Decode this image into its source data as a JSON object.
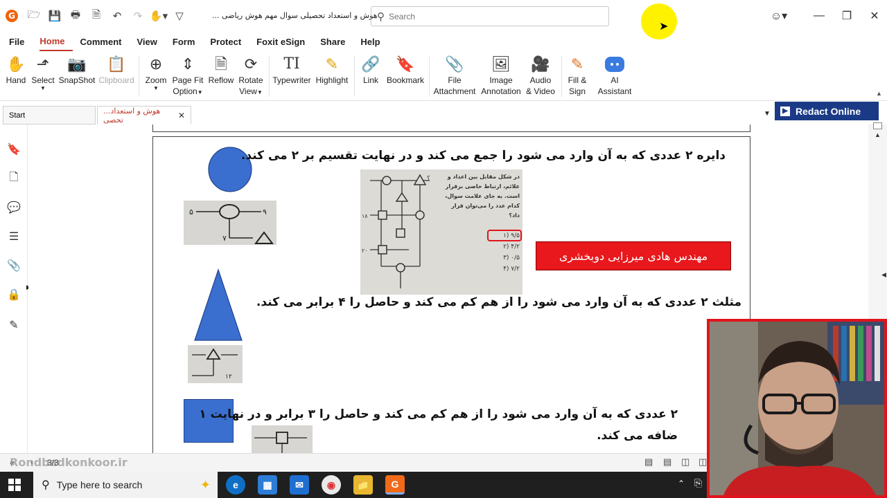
{
  "titlebar": {
    "doc_title": "... هوش و استعداد تحصیلی سوال مهم هوش ریاضی",
    "search_placeholder": "Search"
  },
  "menu": [
    "File",
    "Home",
    "Comment",
    "View",
    "Form",
    "Protect",
    "Foxit eSign",
    "Share",
    "Help"
  ],
  "ribbon": {
    "hand": "Hand",
    "select": "Select",
    "snapshot": "SnapShot",
    "clipboard": "Clipboard",
    "zoom": "Zoom",
    "pagefit_1": "Page Fit",
    "pagefit_2": "Option",
    "reflow": "Reflow",
    "rotate_1": "Rotate",
    "rotate_2": "View",
    "typewriter": "Typewriter",
    "highlight": "Highlight",
    "link": "Link",
    "bookmark": "Bookmark",
    "file_1": "File",
    "file_2": "Attachment",
    "image_1": "Image",
    "image_2": "Annotation",
    "audio_1": "Audio",
    "audio_2": "& Video",
    "fill_1": "Fill &",
    "fill_2": "Sign",
    "ai_1": "AI",
    "ai_2": "Assistant"
  },
  "tabs": {
    "start": "Start",
    "doc": "...هوش و استعداد تحصی"
  },
  "redact_label": "Redact Online",
  "document": {
    "circle_rule": "دایره ۲ عددی که به آن وارد می شود را جمع می کند و در نهایت تقسیم بر ۲ می کند.",
    "triangle_rule": "مثلث ۲ عددی که به آن وارد می شود را از هم کم می کند  و حاصل را ۴ برابر می کند.",
    "square_rule_1": "۲ عددی که به آن وارد می شود را از هم کم می کند  و حاصل را ۳ برابر و در نهایت ۱",
    "square_rule_2": "ضافه می کند.",
    "banner": "مهندس هادی میرزایی دوبخشری",
    "scan_text_1": "در شکل مقابل بین اعداد و",
    "scan_text_2": "علائم، ارتباط خاصی برقرار",
    "scan_text_3": "است. به جای علامت سوال،",
    "scan_text_4": "کدام عدد را می‌توان قرار",
    "scan_text_5": "داد؟",
    "opt_1": "۹/۵ (۱",
    "opt_2": "۴/۲ (۲",
    "opt_3": "۰/۵ (۳",
    "opt_4": "۷/۲ (۴"
  },
  "status": {
    "page": "3/3",
    "watermark": "Rondbadkonkoor.ir"
  },
  "taskbar": {
    "search_placeholder": "Type here to search"
  },
  "colors": {
    "shape_blue": "#3a6fd0",
    "banner_red": "#e8181c",
    "redact_blue": "#1a3a86",
    "webcam_border": "#e0141c"
  }
}
